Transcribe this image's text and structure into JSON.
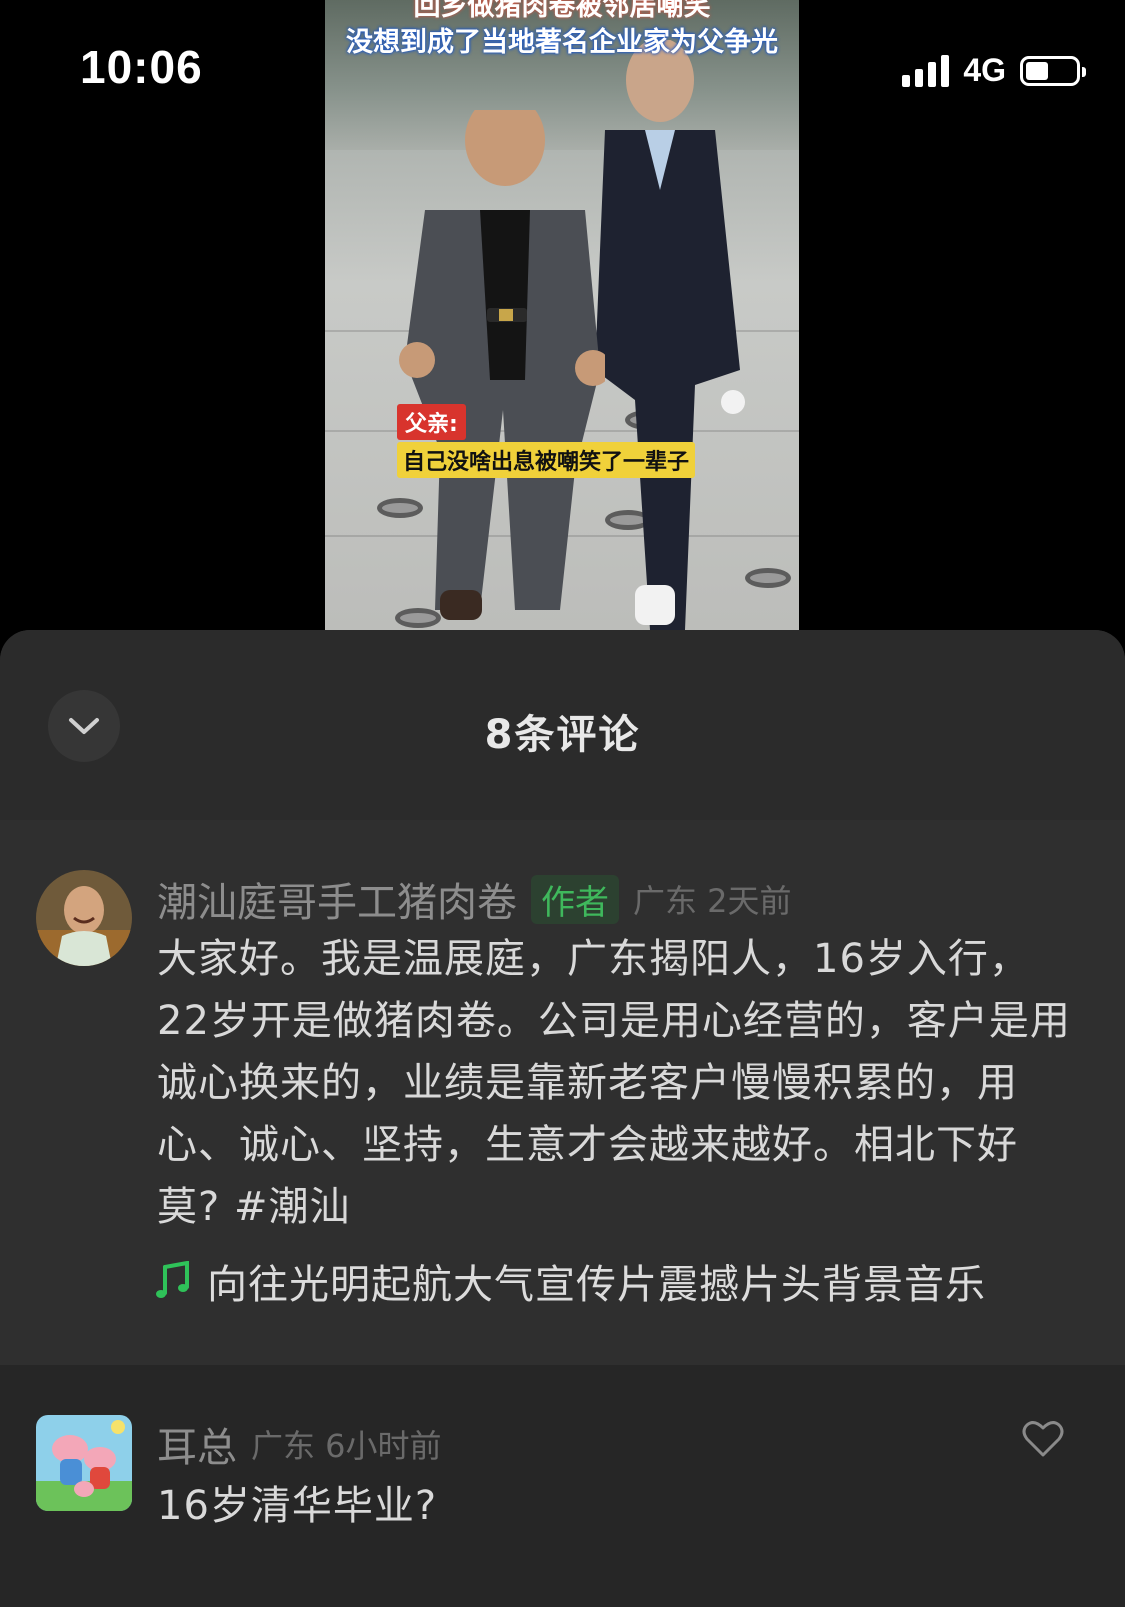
{
  "status_bar": {
    "time": "10:06",
    "network": "4G",
    "battery_level": 0.45
  },
  "video": {
    "title_line1": "回乡做猪肉卷被邻居嘲笑",
    "title_line2": "没想到成了当地著名企业家为父争光",
    "caption_speaker": "父亲:",
    "caption_text": "自己没啥出息被嘲笑了一辈子"
  },
  "sheet": {
    "title": "8条评论",
    "collapse_icon": "chevron-down-icon"
  },
  "comments": [
    {
      "username": "潮汕庭哥手工猪肉卷",
      "badge": "作者",
      "meta": "广东 2天前",
      "text": "大家好。我是温展庭，广东揭阳人，16岁入行，22岁开是做猪肉卷。公司是用心经营的，客户是用诚心换来的，业绩是靠新老客户慢慢积累的，用心、诚心、坚持，生意才会越来越好。相北下好莫? #潮汕",
      "music": "向往光明起航大气宣传片震撼片头背景音乐",
      "music_icon": "music-note-icon"
    },
    {
      "username": "耳总",
      "meta": "广东 6小时前",
      "text": "16岁清华毕业?",
      "like_icon": "heart-outline-icon"
    }
  ],
  "colors": {
    "sheet_bg": "#2b2b2b",
    "author_badge": "#3fb85c",
    "music_icon": "#2fc259"
  }
}
